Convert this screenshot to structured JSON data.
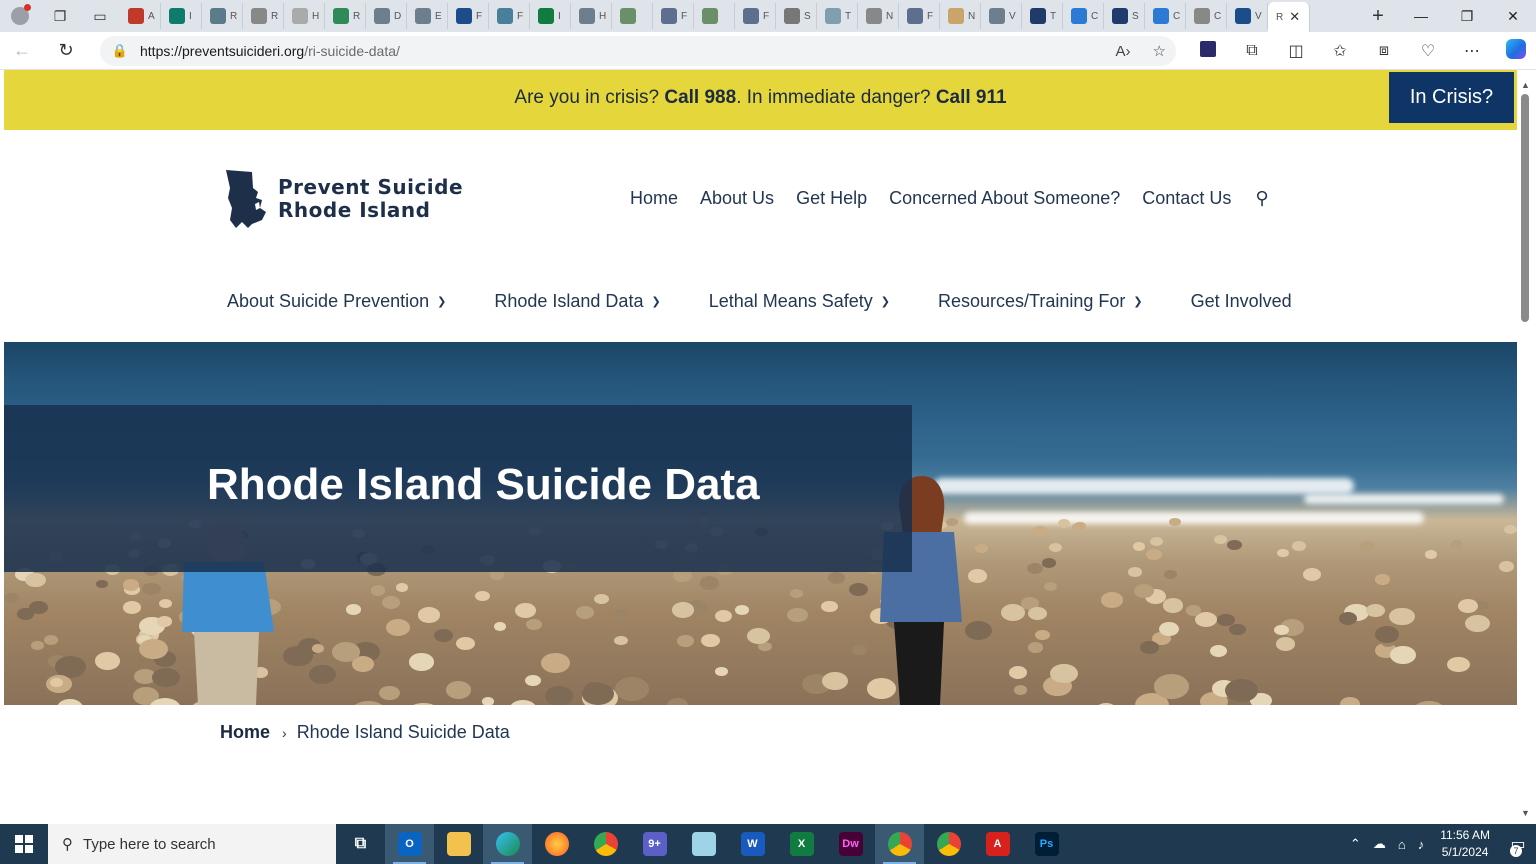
{
  "browser": {
    "active_tab_label": "R",
    "url_host": "https://preventsuicideri.org",
    "url_path": "/ri-suicide-data/",
    "tab_letters": [
      "A",
      "I",
      "R",
      "R",
      "H",
      "R",
      "D",
      "E",
      "F",
      "F",
      "I",
      "H",
      "",
      "F",
      "",
      "F",
      "S",
      "T",
      "N",
      "F",
      "N",
      "V",
      "T",
      "C",
      "S",
      "C",
      "C",
      "V"
    ]
  },
  "crisis_banner": {
    "text_1": "Are you in crisis? ",
    "call_988": "Call 988",
    "text_2": ". In immediate danger? ",
    "call_911": "Call 911",
    "button": "In Crisis?",
    "colors": {
      "background": "#e5d63b",
      "button": "#0f3567"
    }
  },
  "header": {
    "logo_line1": "Prevent Suicide",
    "logo_line2": "Rhode Island",
    "top_nav": [
      "Home",
      "About Us",
      "Get Help",
      "Concerned About Someone?",
      "Contact Us"
    ],
    "search_icon": "search-icon",
    "main_nav": [
      {
        "label": "About Suicide Prevention",
        "has_dropdown": true
      },
      {
        "label": "Rhode Island Data",
        "has_dropdown": true
      },
      {
        "label": "Lethal Means Safety",
        "has_dropdown": true
      },
      {
        "label": "Resources/Training For",
        "has_dropdown": true
      },
      {
        "label": "Get Involved",
        "has_dropdown": false
      }
    ]
  },
  "hero": {
    "title": "Rhode Island Suicide Data"
  },
  "breadcrumb": {
    "home": "Home",
    "current": "Rhode Island Suicide Data"
  },
  "taskbar": {
    "search_placeholder": "Type here to search",
    "time": "11:56 AM",
    "date": "5/1/2024",
    "teams_badge": "9+",
    "notifications": "7"
  }
}
